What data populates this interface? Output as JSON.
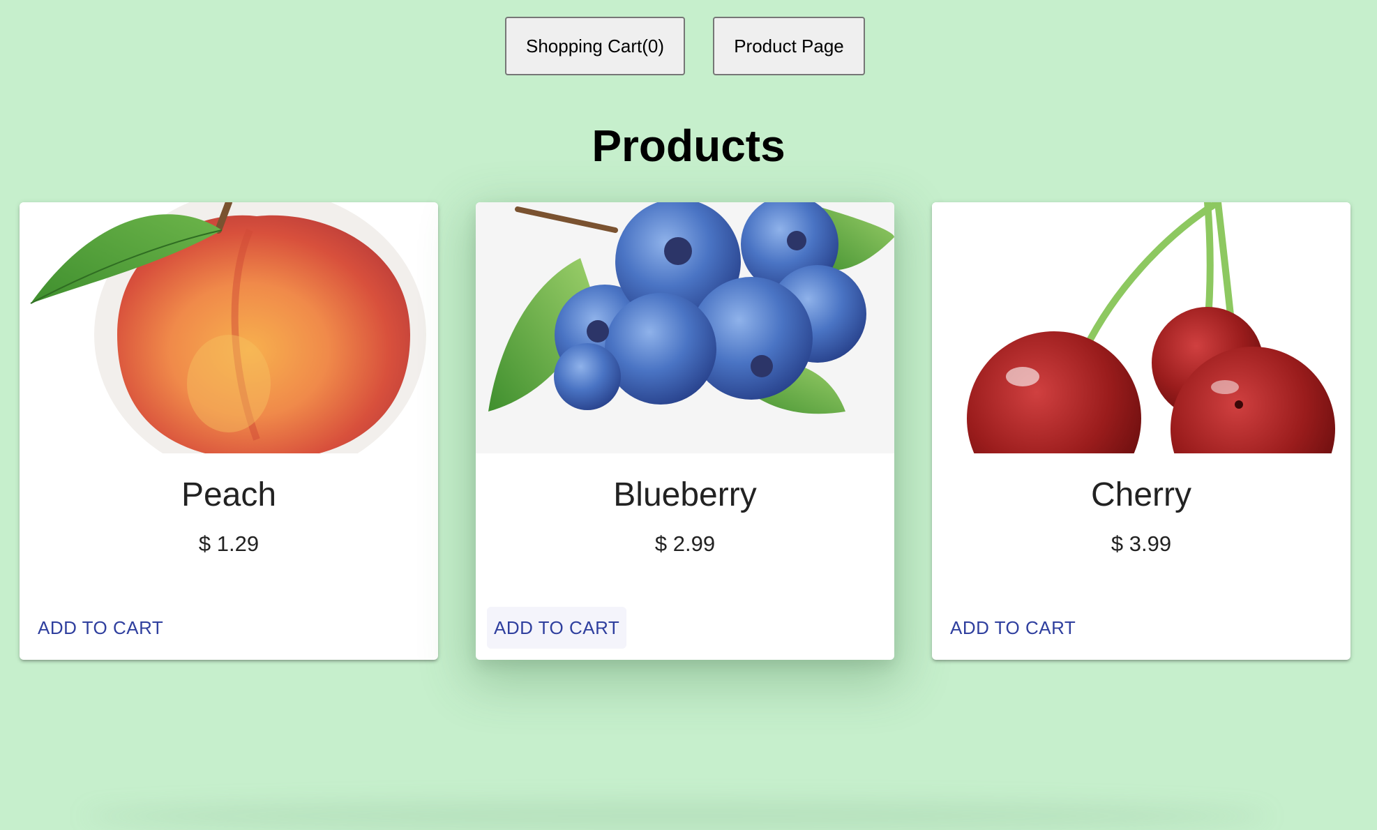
{
  "nav": {
    "cart_label": "Shopping Cart(0)",
    "product_page_label": "Product Page"
  },
  "page": {
    "title": "Products"
  },
  "products": [
    {
      "name": "Peach",
      "price": "$ 1.29",
      "button": "ADD TO CART",
      "image_icon": "peach-image"
    },
    {
      "name": "Blueberry",
      "price": "$ 2.99",
      "button": "ADD TO CART",
      "image_icon": "blueberry-image"
    },
    {
      "name": "Cherry",
      "price": "$ 3.99",
      "button": "ADD TO CART",
      "image_icon": "cherry-image"
    }
  ],
  "colors": {
    "background": "#c6efcc",
    "accent": "#2f3f9e",
    "card": "#ffffff"
  }
}
